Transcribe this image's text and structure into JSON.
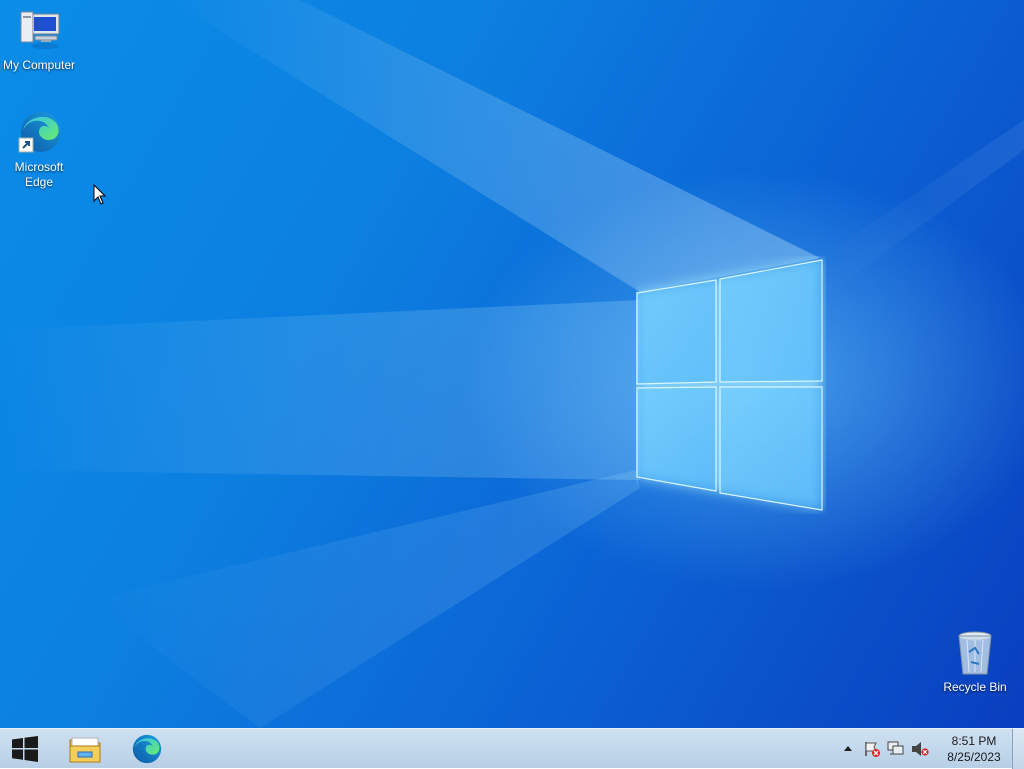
{
  "desktop": {
    "icons": [
      {
        "label": "My Computer",
        "icon": "computer-icon"
      },
      {
        "label": "Microsoft\nEdge",
        "icon": "edge-icon"
      },
      {
        "label": "Recycle Bin",
        "icon": "recycle-bin-icon"
      }
    ],
    "wallpaper": "windows-10-hero",
    "colors": {
      "accent": "#0b7be0",
      "dark": "#0a3fbf",
      "light": "#7fd6ff"
    }
  },
  "taskbar": {
    "start_icon": "windows-start-icon",
    "pinned": [
      {
        "name": "File Explorer",
        "icon": "folder-icon"
      },
      {
        "name": "Microsoft Edge",
        "icon": "edge-icon"
      }
    ],
    "tray": {
      "overflow_icon": "chevron-up-icon",
      "icons": [
        "action-center-flag-icon",
        "network-icon",
        "volume-muted-icon"
      ]
    },
    "clock": {
      "time": "8:51 PM",
      "date": "8/25/2023"
    }
  }
}
